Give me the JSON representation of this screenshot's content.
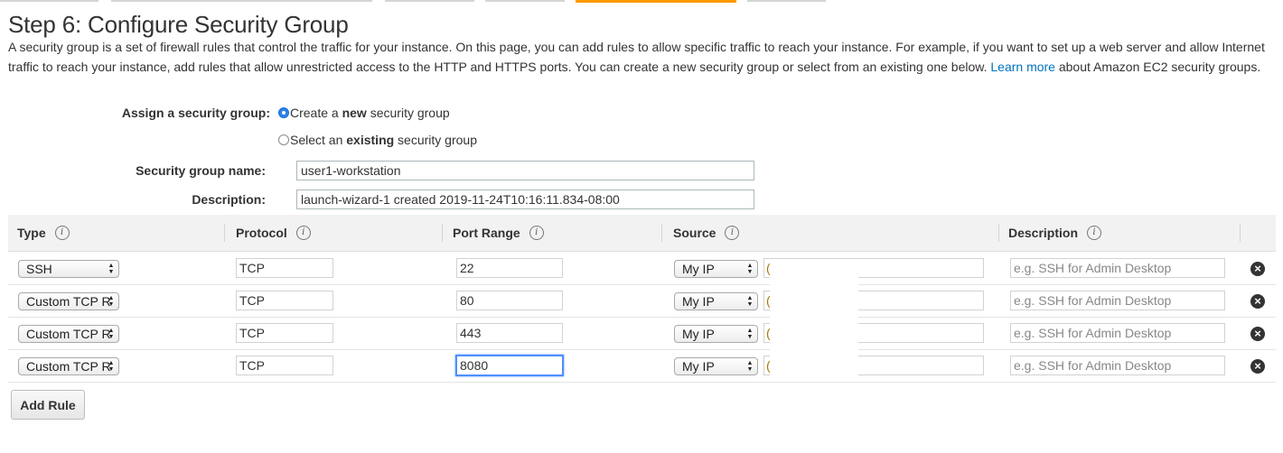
{
  "page": {
    "title": "Step 6: Configure Security Group",
    "intro_text": "A security group is a set of firewall rules that control the traffic for your instance. On this page, you can add rules to allow specific traffic to reach your instance. For example, if you want to set up a web server and allow Internet traffic to reach your instance, add rules that allow unrestricted access to the HTTP and HTTPS ports. You can create a new security group or select from an existing one below.",
    "learn_more": "Learn more",
    "intro_suffix": "about Amazon EC2 security groups."
  },
  "form": {
    "assign_label": "Assign a security group:",
    "option_new_prefix": "Create a ",
    "option_new_bold": "new",
    "option_new_suffix": " security group",
    "option_existing_prefix": "Select an ",
    "option_existing_bold": "existing",
    "option_existing_suffix": " security group",
    "selected_option": "new",
    "name_label": "Security group name:",
    "name_value": "user1-workstation",
    "description_label": "Description:",
    "description_value": "launch-wizard-1 created 2019-11-24T10:16:11.834-08:00"
  },
  "table": {
    "headers": {
      "type": "Type",
      "protocol": "Protocol",
      "port_range": "Port Range",
      "source": "Source",
      "description": "Description"
    },
    "info_glyph": "i",
    "rows": [
      {
        "type": "SSH",
        "protocol": "TCP",
        "port": "22",
        "source": "My IP",
        "cidr_peek": "(",
        "description_placeholder": "e.g. SSH for Admin Desktop"
      },
      {
        "type": "Custom TCP R",
        "protocol": "TCP",
        "port": "80",
        "source": "My IP",
        "cidr_peek": "(",
        "description_placeholder": "e.g. SSH for Admin Desktop"
      },
      {
        "type": "Custom TCP R",
        "protocol": "TCP",
        "port": "443",
        "source": "My IP",
        "cidr_peek": "(",
        "description_placeholder": "e.g. SSH for Admin Desktop"
      },
      {
        "type": "Custom TCP R",
        "protocol": "TCP",
        "port": "8080",
        "source": "My IP",
        "cidr_peek": "(",
        "description_placeholder": "e.g. SSH for Admin Desktop"
      }
    ],
    "remove_glyph": "×"
  },
  "actions": {
    "add_rule": "Add Rule"
  },
  "icons": {
    "info": "info-icon",
    "remove": "remove-icon",
    "select_arrows": "updown-arrows-icon"
  },
  "colors": {
    "accent_tab": "#ff9900",
    "link": "#0073bb",
    "focus": "#4d90fe"
  }
}
